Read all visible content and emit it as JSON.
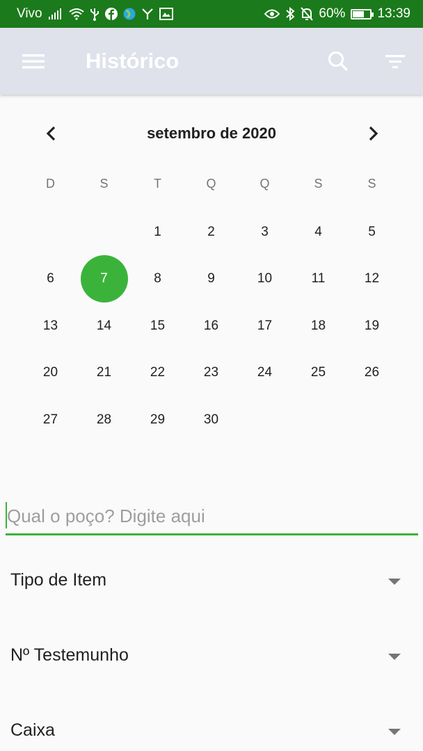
{
  "status_bar": {
    "carrier": "Vivo",
    "battery_percent": "60%",
    "battery_level": 0.6,
    "time": "13:39",
    "icons_left": [
      "signal-icon",
      "wifi-icon",
      "usb-icon",
      "facebook-icon",
      "globe-icon",
      "antenna-icon",
      "gallery-icon"
    ],
    "icons_right": [
      "eye-icon",
      "bluetooth-icon",
      "bell-off-icon",
      "battery-icon"
    ],
    "background": "#1b7a1b"
  },
  "app_bar": {
    "title": "Histórico",
    "background": "#dfe1eb",
    "icons": [
      "menu-icon",
      "search-icon",
      "filter-icon"
    ]
  },
  "calendar": {
    "month_label": "setembro de 2020",
    "weekdays": [
      "D",
      "S",
      "T",
      "Q",
      "Q",
      "S",
      "S"
    ],
    "days": [
      "",
      "",
      "1",
      "2",
      "3",
      "4",
      "5",
      "6",
      "7",
      "8",
      "9",
      "10",
      "11",
      "12",
      "13",
      "14",
      "15",
      "16",
      "17",
      "18",
      "19",
      "20",
      "21",
      "22",
      "23",
      "24",
      "25",
      "26",
      "27",
      "28",
      "29",
      "30"
    ],
    "selected_day": "7",
    "accent": "#3bb33b"
  },
  "search": {
    "value": "",
    "placeholder": "Qual o poço? Digite aqui"
  },
  "dropdowns": [
    {
      "label": "Tipo de Item"
    },
    {
      "label": "Nº Testemunho"
    },
    {
      "label": "Caixa"
    }
  ]
}
